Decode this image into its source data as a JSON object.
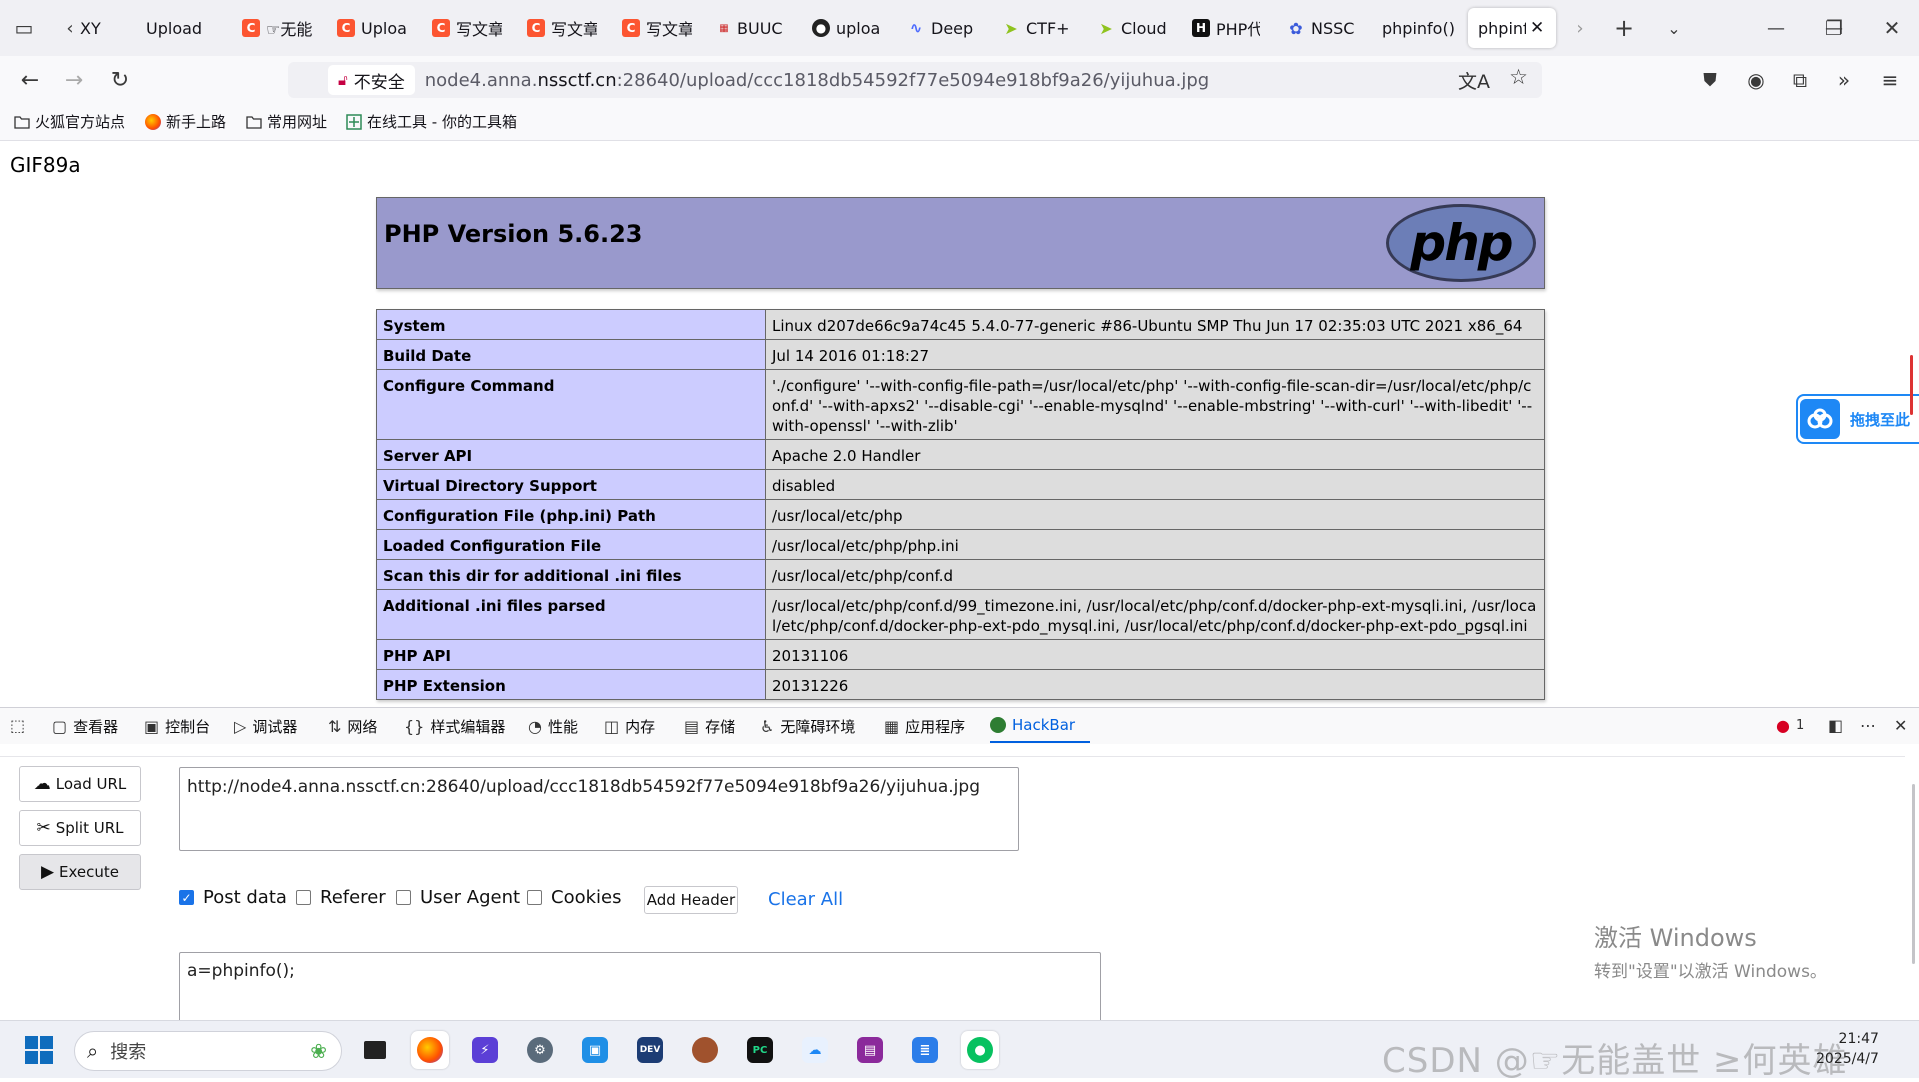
{
  "browser": {
    "tabs": [
      {
        "label": "XY",
        "icon": "document-icon",
        "color": "#888888"
      },
      {
        "label": "Upload",
        "icon": "",
        "color": ""
      },
      {
        "label": "☞无能",
        "icon": "csdn-c-icon",
        "color": "#fc5531"
      },
      {
        "label": "Uploa",
        "icon": "csdn-c-icon",
        "color": "#fc5531"
      },
      {
        "label": "写文章",
        "icon": "csdn-c-icon",
        "color": "#fc5531"
      },
      {
        "label": "写文章",
        "icon": "csdn-c-icon",
        "color": "#fc5531"
      },
      {
        "label": "写文章",
        "icon": "csdn-c-icon",
        "color": "#fc5531"
      },
      {
        "label": "BUUC",
        "icon": "buuctf-icon",
        "color": "#cc2222"
      },
      {
        "label": "uploa",
        "icon": "github-icon",
        "color": "#222222"
      },
      {
        "label": "Deep",
        "icon": "deepseek-icon",
        "color": "#4d6bfe"
      },
      {
        "label": "CTF+",
        "icon": "ctf-icon",
        "color": "#8fc31f"
      },
      {
        "label": "Cloud",
        "icon": "ctf-icon",
        "color": "#8fc31f"
      },
      {
        "label": "PHP代",
        "icon": "h-icon",
        "color": "#111111"
      },
      {
        "label": "NSSC",
        "icon": "paw-icon",
        "color": "#3b5bdb"
      },
      {
        "label": "phpinfo()",
        "icon": "",
        "color": ""
      },
      {
        "label": "phpinf",
        "icon": "",
        "color": "",
        "active": true
      }
    ],
    "insecure_label": "不安全",
    "url_host_prefix": "node4.anna.",
    "url_host_main": "nssctf.cn",
    "url_rest": ":28640/upload/ccc1818db54592f77e5094e918bf9a26/yijuhua.jpg",
    "bookmarks": [
      "火狐官方站点",
      "新手上路",
      "常用网址",
      "在线工具 - 你的工具箱"
    ]
  },
  "page": {
    "gif_header": "GIF89a",
    "php_title": "PHP Version 5.6.23",
    "php_logo": "php",
    "rows": [
      {
        "key": "System",
        "value": "Linux d207de66c9a74c45 5.4.0-77-generic #86-Ubuntu SMP Thu Jun 17 02:35:03 UTC 2021 x86_64"
      },
      {
        "key": "Build Date",
        "value": "Jul 14 2016 01:18:27"
      },
      {
        "key": "Configure Command",
        "value": "'./configure' '--with-config-file-path=/usr/local/etc/php' '--with-config-file-scan-dir=/usr/local/etc/php/conf.d' '--with-apxs2' '--disable-cgi' '--enable-mysqlnd' '--enable-mbstring' '--with-curl' '--with-libedit' '--with-openssl' '--with-zlib'"
      },
      {
        "key": "Server API",
        "value": "Apache 2.0 Handler"
      },
      {
        "key": "Virtual Directory Support",
        "value": "disabled"
      },
      {
        "key": "Configuration File (php.ini) Path",
        "value": "/usr/local/etc/php"
      },
      {
        "key": "Loaded Configuration File",
        "value": "/usr/local/etc/php/php.ini"
      },
      {
        "key": "Scan this dir for additional .ini files",
        "value": "/usr/local/etc/php/conf.d"
      },
      {
        "key": "Additional .ini files parsed",
        "value": "/usr/local/etc/php/conf.d/99_timezone.ini, /usr/local/etc/php/conf.d/docker-php-ext-mysqli.ini, /usr/local/etc/php/conf.d/docker-php-ext-pdo_mysql.ini, /usr/local/etc/php/conf.d/docker-php-ext-pdo_pgsql.ini"
      },
      {
        "key": "PHP API",
        "value": "20131106"
      },
      {
        "key": "PHP Extension",
        "value": "20131226"
      }
    ],
    "baidu_label": "拖拽至此"
  },
  "devtools": {
    "tabs": [
      "查看器",
      "控制台",
      "调试器",
      "网络",
      "样式编辑器",
      "性能",
      "内存",
      "存储",
      "无障碍环境",
      "应用程序",
      "HackBar"
    ],
    "error_count": "1"
  },
  "hackbar": {
    "load_url": "Load URL",
    "split_url": "Split URL",
    "execute": "Execute",
    "url_value": "http://node4.anna.nssctf.cn:28640/upload/ccc1818db54592f77e5094e918bf9a26/yijuhua.jpg",
    "checks": [
      {
        "label": "Post data",
        "checked": true
      },
      {
        "label": "Referer",
        "checked": false
      },
      {
        "label": "User Agent",
        "checked": false
      },
      {
        "label": "Cookies",
        "checked": false
      }
    ],
    "add_header": "Add Header",
    "clear_all": "Clear All",
    "post_value": "a=phpinfo();"
  },
  "windows": {
    "activate_title": "激活 Windows",
    "activate_sub": "转到\"设置\"以激活 Windows。",
    "search_placeholder": "搜索",
    "watermark": "CSDN @☞无能盖世 ≥何英雄",
    "time": "21:47",
    "date": "2025/4/7"
  }
}
